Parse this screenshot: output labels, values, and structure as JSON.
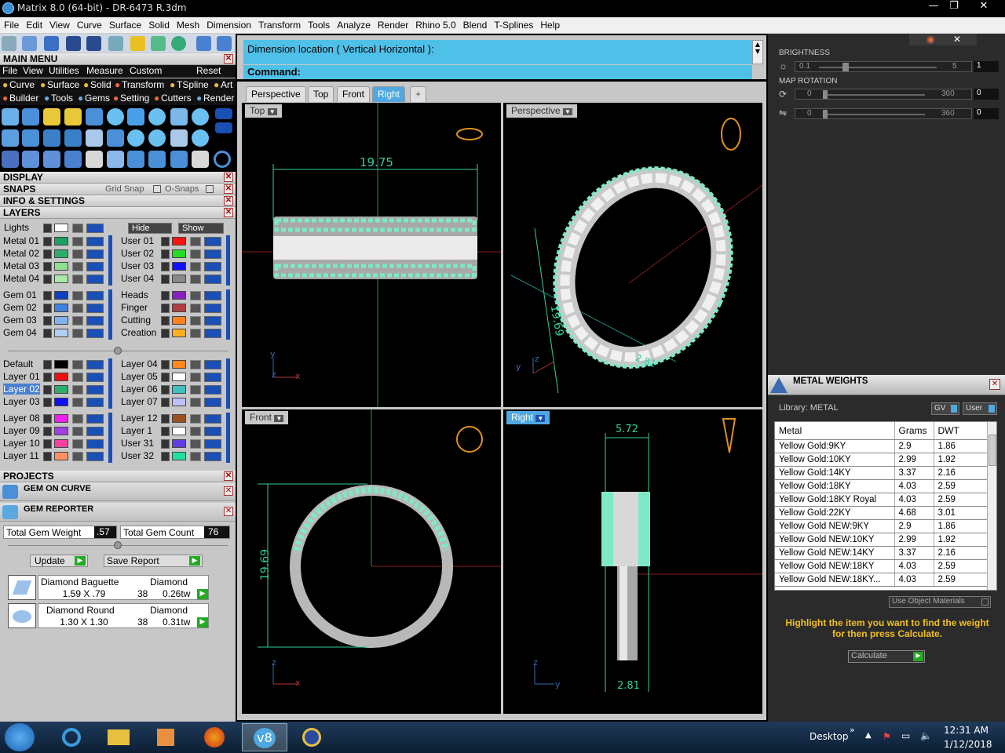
{
  "window": {
    "title": "Matrix 8.0 (64-bit) - DR-6473 R.3dm",
    "minimize": "—",
    "maximize": "❐",
    "close": "✕"
  },
  "menu": [
    "File",
    "Edit",
    "View",
    "Curve",
    "Surface",
    "Solid",
    "Mesh",
    "Dimension",
    "Transform",
    "Tools",
    "Analyze",
    "Render",
    "Rhino 5.0",
    "Blend",
    "T-Splines",
    "Help"
  ],
  "main_menu": {
    "title": "MAIN MENU",
    "row1": [
      "File",
      "View",
      "Utilities",
      "Measure",
      "Custom"
    ],
    "reset": "Reset",
    "row2": [
      "Curve",
      "Surface",
      "Solid",
      "Transform",
      "TSpline",
      "Art"
    ],
    "row3": [
      "Builder",
      "Tools",
      "Gems",
      "Setting",
      "Cutters",
      "Render"
    ]
  },
  "sections": {
    "display": "DISPLAY",
    "snaps": "SNAPS",
    "grid_snap": "Grid Snap",
    "osnaps": "O-Snaps",
    "info": "INFO & SETTINGS",
    "layers": "LAYERS",
    "projects": "PROJECTS"
  },
  "layers": {
    "lights": "Lights",
    "hide": "Hide",
    "show": "Show",
    "left1": [
      {
        "name": "Metal 01",
        "color": "#1aa060"
      },
      {
        "name": "Metal 02",
        "color": "#2aae6a"
      },
      {
        "name": "Metal 03",
        "color": "#8ee08e"
      },
      {
        "name": "Metal 04",
        "color": "#a8e8a8"
      }
    ],
    "right1": [
      {
        "name": "User 01",
        "color": "#ff1010"
      },
      {
        "name": "User 02",
        "color": "#22dd22"
      },
      {
        "name": "User 03",
        "color": "#1010ff"
      },
      {
        "name": "User 04",
        "color": "#888888"
      }
    ],
    "left2": [
      {
        "name": "Gem 01",
        "color": "#1040c0"
      },
      {
        "name": "Gem 02",
        "color": "#4080e0"
      },
      {
        "name": "Gem 03",
        "color": "#80b0f0"
      },
      {
        "name": "Gem 04",
        "color": "#b0d0f8"
      }
    ],
    "right2": [
      {
        "name": "Heads",
        "color": "#8a20c0"
      },
      {
        "name": "Finger",
        "color": "#b04040"
      },
      {
        "name": "Cutting",
        "color": "#ff8020"
      },
      {
        "name": "Creation",
        "color": "#ffb020"
      }
    ],
    "left3": [
      {
        "name": "Default",
        "color": "#000000"
      },
      {
        "name": "Layer 01",
        "color": "#ee1010"
      },
      {
        "name": "Layer 02",
        "color": "#2aae6a"
      },
      {
        "name": "Layer 03",
        "color": "#1010ee"
      }
    ],
    "right3": [
      {
        "name": "Layer 04",
        "color": "#ff8820"
      },
      {
        "name": "Layer 05",
        "color": "#ffffff"
      },
      {
        "name": "Layer 06",
        "color": "#40c0c0"
      },
      {
        "name": "Layer 07",
        "color": "#c0c0ff"
      }
    ],
    "left4": [
      {
        "name": "Layer 08",
        "color": "#ee20ee"
      },
      {
        "name": "Layer 09",
        "color": "#a040e0"
      },
      {
        "name": "Layer 10",
        "color": "#ff40a0"
      },
      {
        "name": "Layer 11",
        "color": "#ff9060"
      }
    ],
    "right4": [
      {
        "name": "Layer 12",
        "color": "#a05020"
      },
      {
        "name": "Layer 1",
        "color": "#ffffff"
      },
      {
        "name": "User 31",
        "color": "#6040e0"
      },
      {
        "name": "User 32",
        "color": "#20e0a0"
      }
    ]
  },
  "projects": {
    "gem_on_curve": "GEM ON CURVE",
    "gem_reporter": "GEM REPORTER",
    "total_weight_label": "Total Gem Weight",
    "total_weight": ".57",
    "total_count_label": "Total Gem Count",
    "total_count": "76",
    "update": "Update",
    "save_report": "Save Report",
    "gems": [
      {
        "type": "Diamond Baguette",
        "material": "Diamond",
        "size": "1.59 X .79",
        "count": "38",
        "tw": "0.26tw"
      },
      {
        "type": "Diamond Round",
        "material": "Diamond",
        "size": "1.30 X 1.30",
        "count": "38",
        "tw": "0.31tw"
      }
    ]
  },
  "command": {
    "prompt": "Dimension location ( Vertical  Horizontal ):",
    "command_label": "Command:"
  },
  "tabs": [
    "Perspective",
    "Top",
    "Front",
    "Right",
    "+"
  ],
  "viewports": {
    "top": "Top",
    "perspective": "Perspective",
    "front": "Front",
    "right": "Right",
    "dims": {
      "top_width": "19.75",
      "persp_a": "19.69",
      "persp_b": "2.81",
      "front_height": "19.69",
      "right_width": "5.72",
      "right_bottom": "2.81"
    },
    "axes": {
      "y": "y",
      "x": "x",
      "z": "z"
    }
  },
  "lighting": {
    "brightness_label": "BRIGHTNESS",
    "bright_min": "0.1",
    "bright_max": "5",
    "bright_val": "1",
    "bright_level": 0.2,
    "map_rotation_label": "MAP ROTATION",
    "rot1_min": "0",
    "rot1_max": "360",
    "rot1_val": "0",
    "rot2_min": "0",
    "rot2_max": "360",
    "rot2_val": "0"
  },
  "metal_weights": {
    "title": "METAL WEIGHTS",
    "library": "Library: METAL",
    "gv": "GV",
    "user": "User",
    "headers": [
      "Metal",
      "Grams",
      "DWT"
    ],
    "rows": [
      [
        "Yellow Gold:9KY",
        "2.9",
        "1.86"
      ],
      [
        "Yellow Gold:10KY",
        "2.99",
        "1.92"
      ],
      [
        "Yellow Gold:14KY",
        "3.37",
        "2.16"
      ],
      [
        "Yellow Gold:18KY",
        "4.03",
        "2.59"
      ],
      [
        "Yellow Gold:18KY Royal",
        "4.03",
        "2.59"
      ],
      [
        "Yellow Gold:22KY",
        "4.68",
        "3.01"
      ],
      [
        "Yellow Gold NEW:9KY",
        "2.9",
        "1.86"
      ],
      [
        "Yellow Gold NEW:10KY",
        "2.99",
        "1.92"
      ],
      [
        "Yellow Gold NEW:14KY",
        "3.37",
        "2.16"
      ],
      [
        "Yellow Gold NEW:18KY",
        "4.03",
        "2.59"
      ],
      [
        "Yellow Gold NEW:18KY...",
        "4.03",
        "2.59"
      ]
    ],
    "use_object": "Use Object Materials",
    "hint": "Highlight the item you want to find the weight for then press Calculate.",
    "calculate": "Calculate"
  },
  "taskbar": {
    "desktop": "Desktop",
    "time": "12:31 AM",
    "date": "1/12/2018"
  }
}
